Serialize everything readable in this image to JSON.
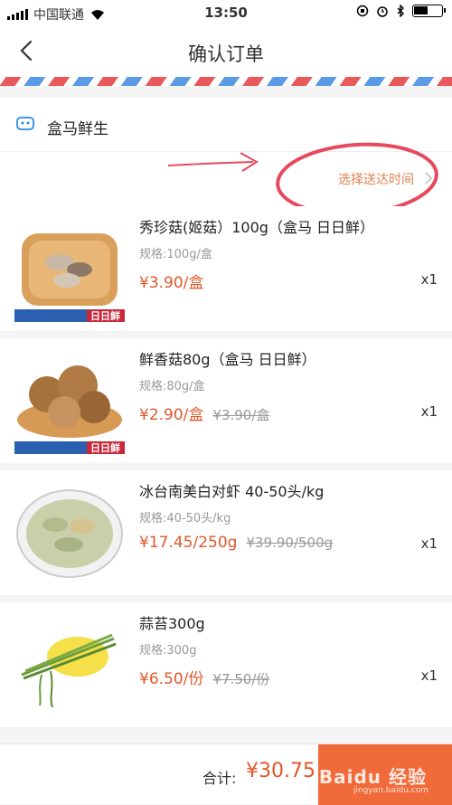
{
  "status_bar": {
    "carrier": "中国联通",
    "time": "13:50",
    "battery_level": 0.5
  },
  "nav": {
    "title": "确认订单"
  },
  "store": {
    "name": "盒马鲜生"
  },
  "delivery": {
    "label": "选择送达时间"
  },
  "items": [
    {
      "name": "秀珍菇(姬菇）100g（盒马 日日鲜）",
      "spec": "规格:100g/盒",
      "price": "¥3.90/盒",
      "original_price": "",
      "qty": "x1",
      "brand_label": "日日鲜"
    },
    {
      "name": "鲜香菇80g（盒马 日日鲜）",
      "spec": "规格:80g/盒",
      "price": "¥2.90/盒",
      "original_price": "¥3.90/盒",
      "qty": "x1",
      "brand_label": "日日鲜"
    },
    {
      "name": "冰台南美白对虾 40-50头/kg",
      "spec": "规格:40-50头/kg",
      "price": "¥17.45/250g",
      "original_price": "¥39.90/500g",
      "qty": "x1"
    },
    {
      "name": "蒜苔300g",
      "spec": "规格:300g",
      "price": "¥6.50/份",
      "original_price": "¥7.50/份",
      "qty": "x1"
    }
  ],
  "footer": {
    "total_label": "合计:",
    "total_value": "¥30.75"
  },
  "colors": {
    "accent": "#e0572a",
    "submit_bg": "#f06a3a",
    "annotation": "#e64a5e"
  }
}
